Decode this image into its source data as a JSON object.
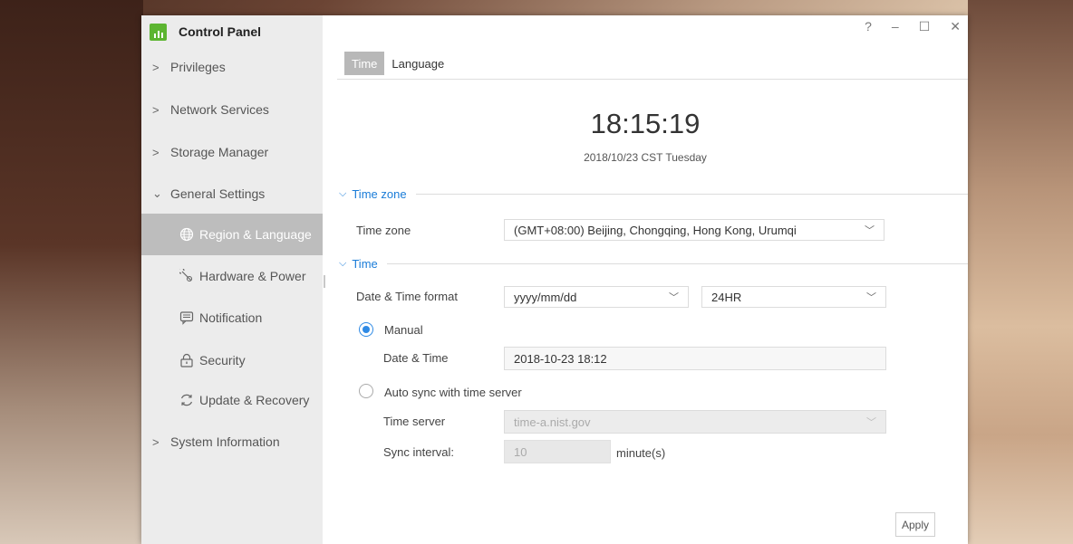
{
  "app": {
    "title": "Control Panel"
  },
  "window_controls": {
    "help": "?",
    "minimize": "–",
    "maximize": "☐",
    "close": "✕"
  },
  "sidebar": {
    "items": [
      {
        "label": "Privileges",
        "chevron": ">"
      },
      {
        "label": "Network Services",
        "chevron": ">"
      },
      {
        "label": "Storage Manager",
        "chevron": ">"
      },
      {
        "label": "General Settings",
        "chevron": "⌄"
      }
    ],
    "sub_items": [
      {
        "label": "Region & Language",
        "icon": "globe-icon",
        "active": true
      },
      {
        "label": "Hardware & Power",
        "icon": "wrench-icon"
      },
      {
        "label": "Notification",
        "icon": "message-icon"
      },
      {
        "label": "Security",
        "icon": "lock-icon"
      },
      {
        "label": "Update & Recovery",
        "icon": "refresh-icon"
      }
    ],
    "system_info": {
      "label": "System Information",
      "chevron": ">"
    }
  },
  "tabs": [
    {
      "label": "Time",
      "active": true
    },
    {
      "label": "Language",
      "active": false
    }
  ],
  "clock": {
    "time": "18:15:19",
    "date": "2018/10/23 CST Tuesday"
  },
  "sections": {
    "timezone": {
      "title": "Time zone",
      "field_label": "Time zone",
      "value": "(GMT+08:00) Beijing, Chongqing, Hong Kong, Urumqi"
    },
    "time": {
      "title": "Time",
      "format_label": "Date & Time format",
      "date_format": "yyyy/mm/dd",
      "hour_format": "24HR",
      "manual_label": "Manual",
      "manual_selected": true,
      "datetime_label": "Date & Time",
      "datetime_value": "2018-10-23 18:12",
      "auto_sync_label": "Auto sync with time server",
      "server_label": "Time server",
      "server_value": "time-a.nist.gov",
      "interval_label": "Sync interval:",
      "interval_value": "10",
      "interval_unit": "minute(s)"
    }
  },
  "apply_label": "Apply",
  "colors": {
    "accent": "#2f8ae5",
    "logo": "#5cb531",
    "active_item": "#bdbdbd"
  }
}
